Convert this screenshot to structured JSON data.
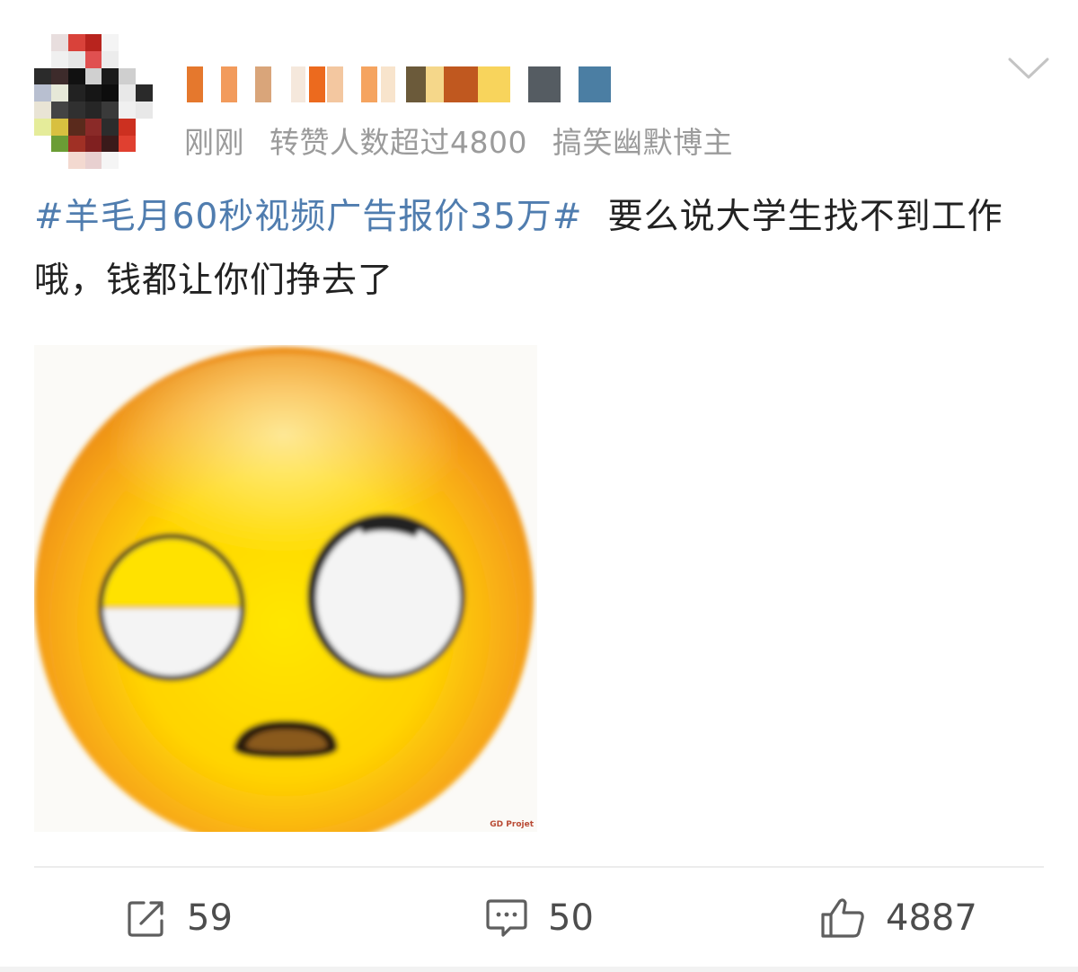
{
  "post": {
    "meta": {
      "time": "刚刚",
      "repost_badge": "转赞人数超过4800",
      "category": "搞笑幽默博主"
    },
    "hashtag": "#羊毛月60秒视频广告报价35万#",
    "body": "要么说大学生找不到工作哦，钱都让你们挣去了",
    "image": {
      "watermark": "GD Projet"
    },
    "actions": {
      "repost_count": "59",
      "comment_count": "50",
      "like_count": "4887"
    }
  },
  "colors": {
    "hashtag": "#507daf",
    "meta_text": "#9b9b9b",
    "body_text": "#222222",
    "icon": "#5e5e5e"
  },
  "icons": {
    "more": "chevron-down-icon",
    "repost": "repost-icon",
    "comment": "comment-icon",
    "like": "thumbs-up-icon"
  }
}
